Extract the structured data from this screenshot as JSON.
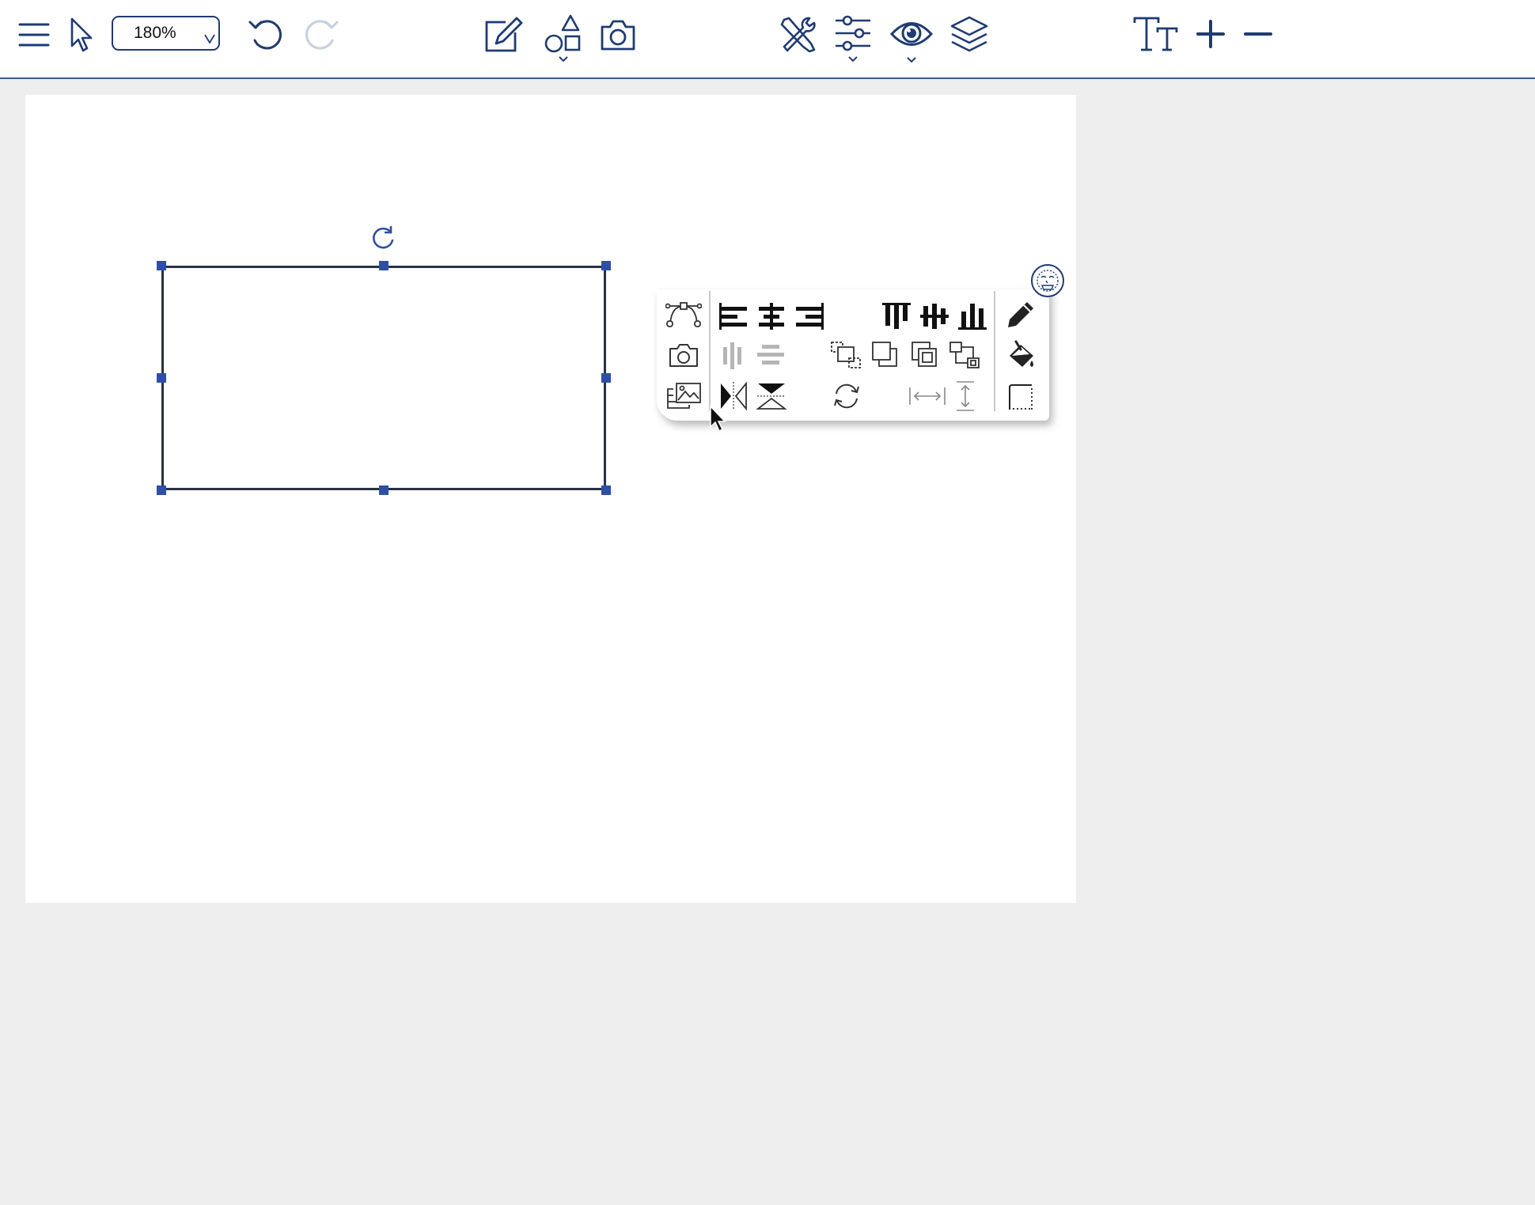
{
  "toolbar": {
    "zoom_value": "180%",
    "icons": {
      "menu": "menu-icon",
      "select": "pointer-icon",
      "zoom_dropdown": "chevron-down-icon",
      "undo": "undo-icon",
      "redo": "redo-icon",
      "edit": "edit-icon",
      "shapes": "shapes-icon",
      "camera": "camera-icon",
      "tools": "tools-icon",
      "adjust": "sliders-icon",
      "view": "eye-icon",
      "layers": "layers-icon",
      "text": "text-size-icon",
      "zoom_in": "plus-icon",
      "zoom_out": "minus-icon"
    }
  },
  "colors": {
    "accent": "#1f3b73",
    "handle": "#2e4fa6",
    "shape_stroke": "#2b2f45",
    "disabled": "#b5b5b5",
    "background": "#eeeeee"
  }
}
